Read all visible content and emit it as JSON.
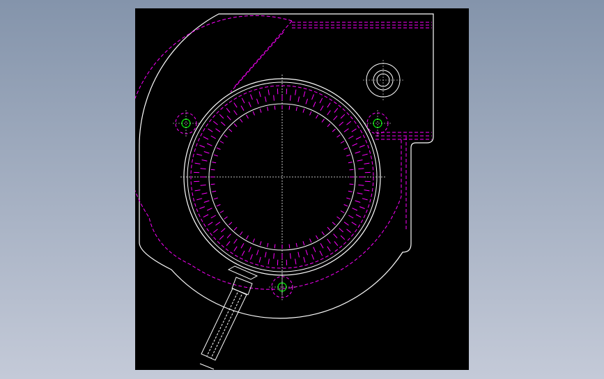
{
  "viewport": {
    "background_top": "#8494ab",
    "background_bottom": "#c4cad8",
    "canvas_background": "#000000"
  },
  "colors": {
    "outline": "#ffffff",
    "hidden_lines": "#ff00ff",
    "center_lines": "#ffffff",
    "holes": "#00ff00"
  },
  "drawing": {
    "view": "top view",
    "features": [
      "housing-outline",
      "outlet-duct",
      "motor-ring",
      "impeller-blades",
      "mounting-holes",
      "boss-hole",
      "cable-sleeve"
    ]
  }
}
